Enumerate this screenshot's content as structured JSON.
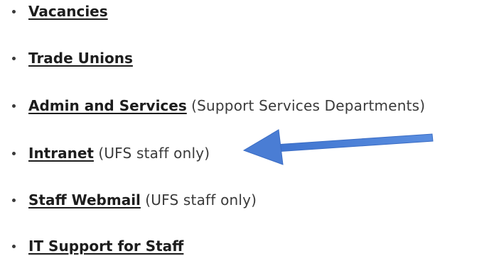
{
  "links": [
    {
      "label": "Vacancies",
      "note": ""
    },
    {
      "label": "Trade Unions",
      "note": ""
    },
    {
      "label": "Admin and Services",
      "note": "(Support Services Departments)"
    },
    {
      "label": "Intranet",
      "note": "(UFS staff only)"
    },
    {
      "label": "Staff Webmail",
      "note": "(UFS staff only)"
    },
    {
      "label": "IT Support for Staff",
      "note": ""
    }
  ],
  "annotation": {
    "arrow_icon": "left-arrow-icon",
    "arrow_color": "#4a7dd4",
    "points_to": "Intranet"
  }
}
